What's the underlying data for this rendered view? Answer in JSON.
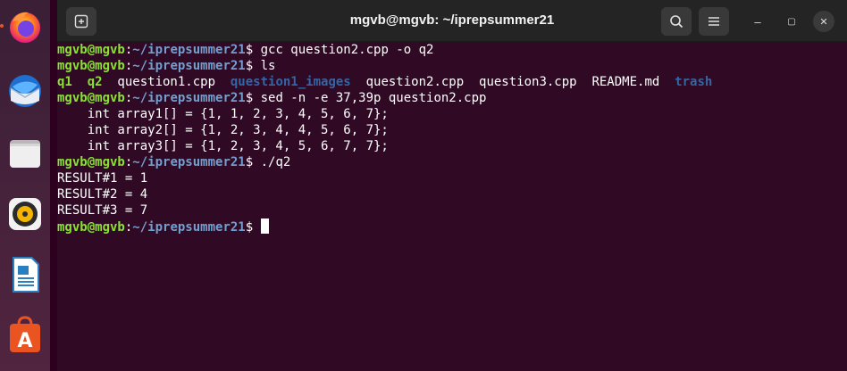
{
  "dock": {
    "items": [
      {
        "name": "firefox-icon",
        "running": true
      },
      {
        "name": "thunderbird-icon",
        "running": false
      },
      {
        "name": "files-icon",
        "running": false
      },
      {
        "name": "rhythmbox-icon",
        "running": false
      },
      {
        "name": "libreoffice-writer-icon",
        "running": false
      },
      {
        "name": "software-center-icon",
        "running": false
      }
    ]
  },
  "window": {
    "title": "mgvb@mgvb: ~/iprepsummer21",
    "new_tab_icon": "new-tab-icon",
    "search_icon": "search-icon",
    "menu_icon": "hamburger-menu-icon",
    "minimize": "–",
    "maximize": "▢",
    "close": "✕"
  },
  "prompt": {
    "user": "mgvb@mgvb",
    "sep": ":",
    "path": "~/iprepsummer21",
    "sym": "$ "
  },
  "lines": [
    {
      "type": "cmd",
      "text": "gcc question2.cpp -o q2"
    },
    {
      "type": "cmd",
      "text": "ls"
    },
    {
      "type": "ls",
      "items": [
        {
          "t": "q1",
          "k": "exe"
        },
        {
          "t": "  ",
          "k": "plain"
        },
        {
          "t": "q2",
          "k": "exe"
        },
        {
          "t": "  question1.cpp  ",
          "k": "plain"
        },
        {
          "t": "question1_images",
          "k": "dir"
        },
        {
          "t": "  question2.cpp  question3.cpp  README.md  ",
          "k": "plain"
        },
        {
          "t": "trash",
          "k": "dir"
        }
      ]
    },
    {
      "type": "cmd",
      "text": "sed -n -e 37,39p question2.cpp"
    },
    {
      "type": "out",
      "text": "    int array1[] = {1, 1, 2, 3, 4, 5, 6, 7};"
    },
    {
      "type": "out",
      "text": "    int array2[] = {1, 2, 3, 4, 4, 5, 6, 7};"
    },
    {
      "type": "out",
      "text": "    int array3[] = {1, 2, 3, 4, 5, 6, 7, 7};"
    },
    {
      "type": "cmd",
      "text": "./q2"
    },
    {
      "type": "out",
      "text": "RESULT#1 = 1"
    },
    {
      "type": "out",
      "text": "RESULT#2 = 4"
    },
    {
      "type": "out",
      "text": "RESULT#3 = 7"
    },
    {
      "type": "cursor",
      "text": ""
    }
  ]
}
